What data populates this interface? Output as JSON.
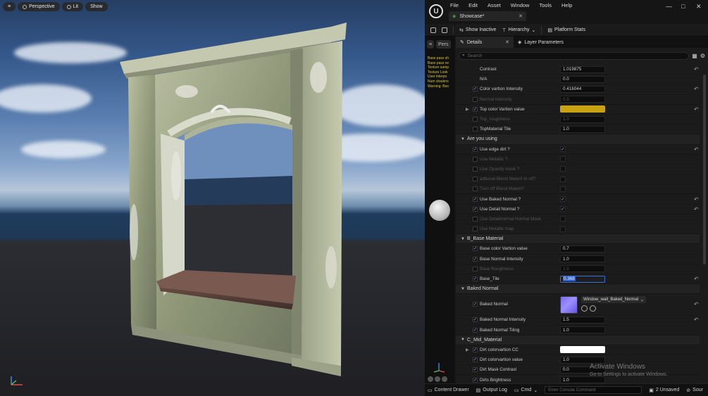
{
  "viewport": {
    "perspective_label": "Perspective",
    "lit_label": "Lit",
    "show_label": "Show"
  },
  "menu": [
    "File",
    "Edit",
    "Asset",
    "Window",
    "Tools",
    "Help"
  ],
  "doc_tab": "Showcase*",
  "toolbar": {
    "show_inactive": "Show Inactive",
    "hierarchy": "Hierarchy",
    "platform_stats": "Platform Stats"
  },
  "preview": {
    "tab_label": "Pers",
    "warnings": [
      "Base pass sh",
      "Base pass ve",
      "Texture samp",
      "Texture Look",
      "User interpo",
      "Num shaders",
      "Warning: Bas"
    ]
  },
  "details": {
    "tab_label": "Details",
    "layer_tab_label": "Layer Parameters",
    "search_placeholder": "Search"
  },
  "rows": [
    {
      "type": "param",
      "label": "Contrast",
      "value": "1.019875",
      "checked": false,
      "enabled": true,
      "reset": true,
      "nochk": true
    },
    {
      "type": "param",
      "label": "N/A",
      "value": "0.0",
      "checked": false,
      "enabled": true,
      "reset": false,
      "nochk": true
    },
    {
      "type": "param",
      "label": "Color vartion Intensity",
      "value": "0.416044",
      "checked": true,
      "enabled": true,
      "reset": true
    },
    {
      "type": "param",
      "label": "Normal Intensity",
      "value": "0.5",
      "checked": false,
      "enabled": false,
      "reset": false
    },
    {
      "type": "color",
      "label": "Top color Vartion value",
      "color": "#c9a214",
      "checked": true,
      "enabled": true,
      "reset": true,
      "expand": true
    },
    {
      "type": "param",
      "label": "Top_roughness",
      "value": "1.0",
      "checked": false,
      "enabled": false,
      "reset": false
    },
    {
      "type": "param",
      "label": "TopMaterial Tile",
      "value": "1.0",
      "checked": false,
      "enabled": true,
      "reset": false
    },
    {
      "type": "cat",
      "label": "Are you using"
    },
    {
      "type": "bool",
      "label": "Use edge dirt ?",
      "on": true,
      "checked": true,
      "enabled": true,
      "reset": true
    },
    {
      "type": "bool",
      "label": "Use Metallic ?",
      "on": false,
      "checked": false,
      "enabled": false,
      "reset": false
    },
    {
      "type": "bool",
      "label": "Use Opacity mask ?",
      "on": false,
      "checked": false,
      "enabled": false,
      "reset": false
    },
    {
      "type": "bool",
      "label": "adtional Blend Materil to off?",
      "on": false,
      "checked": false,
      "enabled": false,
      "reset": false
    },
    {
      "type": "bool",
      "label": "Turn off Blend Materil?",
      "on": false,
      "checked": false,
      "enabled": false,
      "reset": false
    },
    {
      "type": "bool",
      "label": "Use Baked Normal ?",
      "on": true,
      "checked": true,
      "enabled": true,
      "reset": true
    },
    {
      "type": "bool",
      "label": "Use Detail Normal ?",
      "on": true,
      "checked": true,
      "enabled": true,
      "reset": true
    },
    {
      "type": "bool",
      "label": "Use Detailnormal Normal Mask",
      "on": false,
      "checked": false,
      "enabled": false,
      "reset": false
    },
    {
      "type": "bool",
      "label": "Use Metallic map",
      "on": false,
      "checked": false,
      "enabled": false,
      "reset": false
    },
    {
      "type": "cat",
      "label": "B_Base Material"
    },
    {
      "type": "param",
      "label": "Base color Vartion value",
      "value": "0.7",
      "checked": true,
      "enabled": true,
      "reset": false
    },
    {
      "type": "param",
      "label": "Base Normal Intensity",
      "value": "1.0",
      "checked": true,
      "enabled": true,
      "reset": false
    },
    {
      "type": "param",
      "label": "Base Roughness",
      "value": "1.0",
      "checked": false,
      "enabled": false,
      "reset": false
    },
    {
      "type": "param",
      "label": "Base_Tile",
      "value": "0.368",
      "checked": true,
      "enabled": true,
      "reset": true,
      "selected": true
    },
    {
      "type": "cat",
      "label": "Baked Normal"
    },
    {
      "type": "texture",
      "label": "Baked Normal",
      "texture_name": "Window_wall_Baked_Normal",
      "checked": true,
      "enabled": true,
      "reset": true
    },
    {
      "type": "param",
      "label": "Baked Normal Intensity",
      "value": "1.5",
      "checked": true,
      "enabled": true,
      "reset": true
    },
    {
      "type": "param",
      "label": "Baked Normal Tiling",
      "value": "1.0",
      "checked": true,
      "enabled": true,
      "reset": false
    },
    {
      "type": "cat",
      "label": "C_Mid_Material"
    },
    {
      "type": "color",
      "label": "Dirt colorvartion CC",
      "color": "#ffffff",
      "checked": true,
      "enabled": true,
      "reset": false,
      "expand": true
    },
    {
      "type": "param",
      "label": "Dirt colorvartion value",
      "value": "1.0",
      "checked": true,
      "enabled": true,
      "reset": false
    },
    {
      "type": "param",
      "label": "Dirt Mask Contrast",
      "value": "0.0",
      "checked": true,
      "enabled": true,
      "reset": false
    },
    {
      "type": "param",
      "label": "Dirts Brightness",
      "value": "1.0",
      "checked": true,
      "enabled": true,
      "reset": false
    }
  ],
  "watermark": {
    "title": "Activate Windows",
    "subtitle": "Go to Settings to activate Windows."
  },
  "statusbar": {
    "content_drawer": "Content Drawer",
    "output_log": "Output Log",
    "cmd": "Cmd",
    "console_placeholder": "Enter Console Command",
    "unsaved": "2 Unsaved",
    "source": "Sour"
  }
}
